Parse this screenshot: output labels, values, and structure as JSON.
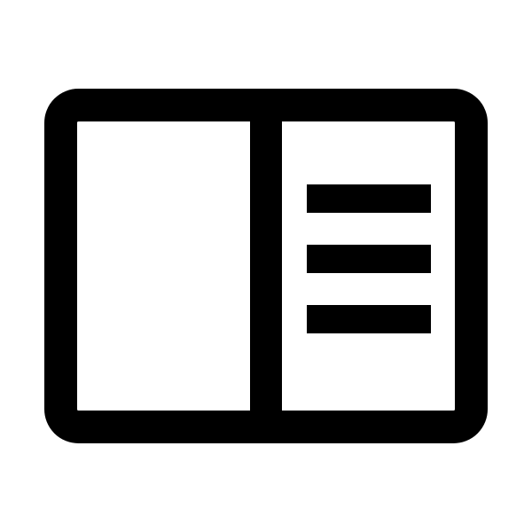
{
  "icon": {
    "name": "panel-left-content-right-icon",
    "description_visible_text": ""
  },
  "colors": {
    "background": "#ffffff",
    "stroke": "#000000"
  }
}
